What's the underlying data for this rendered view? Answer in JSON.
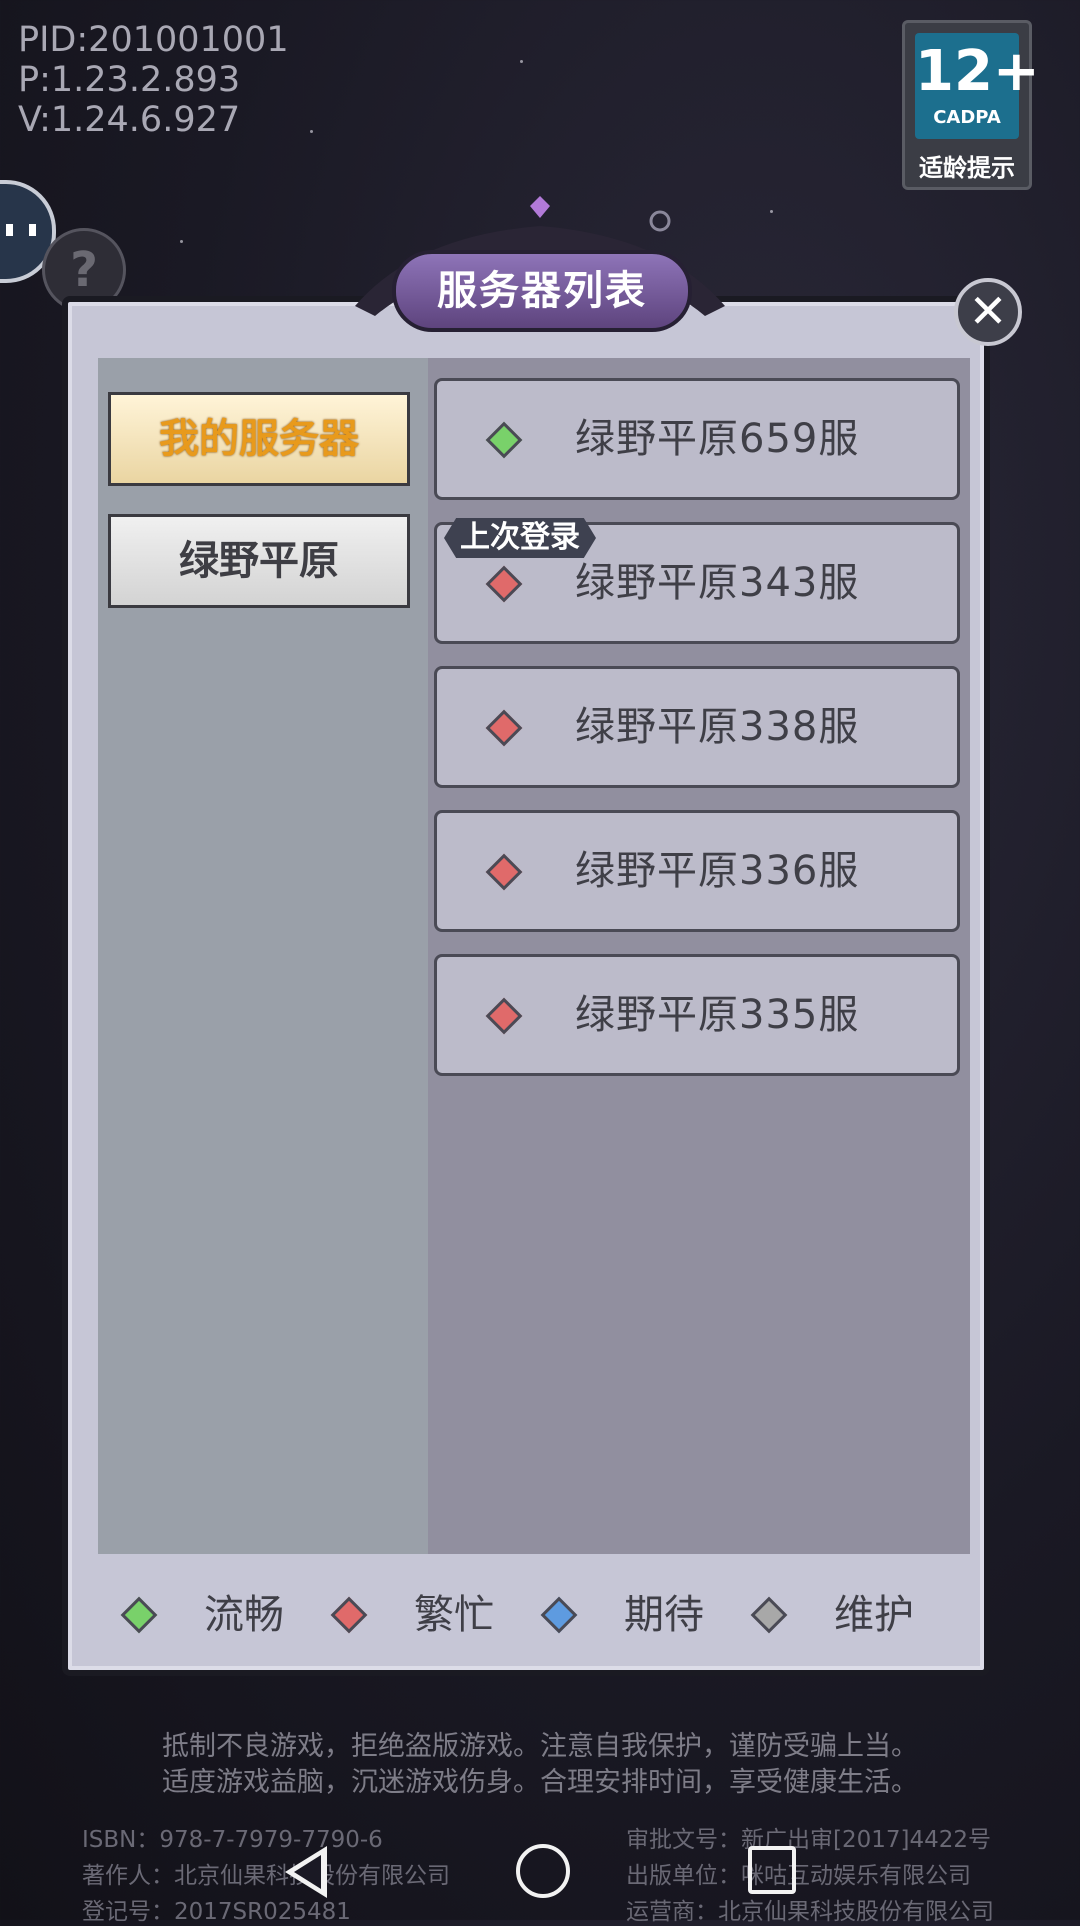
{
  "build_info": {
    "pid": "PID:201001001",
    "p": "P:1.23.2.893",
    "v": "V:1.24.6.927"
  },
  "age_rating": {
    "number": "12+",
    "org": "CADPA",
    "tip": "适龄提示"
  },
  "dialog": {
    "title": "服务器列表",
    "close_icon": "close-icon",
    "categories": [
      {
        "label": "我的服务器",
        "selected": true
      },
      {
        "label": "绿野平原",
        "selected": false
      }
    ],
    "last_login_tag": "上次登录",
    "servers": [
      {
        "name": "绿野平原659服",
        "status": "流畅",
        "color": "#79d16a"
      },
      {
        "name": "绿野平原343服",
        "status": "繁忙",
        "color": "#e06a6a"
      },
      {
        "name": "绿野平原338服",
        "status": "繁忙",
        "color": "#e06a6a"
      },
      {
        "name": "绿野平原336服",
        "status": "繁忙",
        "color": "#e06a6a"
      },
      {
        "name": "绿野平原335服",
        "status": "繁忙",
        "color": "#e06a6a"
      }
    ],
    "legend": [
      {
        "label": "流畅",
        "color": "#79d16a"
      },
      {
        "label": "繁忙",
        "color": "#e06a6a"
      },
      {
        "label": "期待",
        "color": "#5e9be0"
      },
      {
        "label": "维护",
        "color": "#a8a8a8"
      }
    ]
  },
  "notice": {
    "line1": "抵制不良游戏，拒绝盗版游戏。注意自我保护，谨防受骗上当。",
    "line2": "适度游戏益脑，沉迷游戏伤身。合理安排时间，享受健康生活。"
  },
  "footer": {
    "isbn": "ISBN：978-7-7979-7790-6",
    "author": "著作人：北京仙果科技股份有限公司",
    "reg": "登记号：2017SR025481",
    "approval": "审批文号：新广出审[2017]4422号",
    "publisher": "出版单位：咪咕互动娱乐有限公司",
    "operator": "运营商：北京仙果科技股份有限公司"
  },
  "nav": {
    "back_icon": "back-icon",
    "home_icon": "home-icon",
    "recent_icon": "recent-apps-icon"
  }
}
